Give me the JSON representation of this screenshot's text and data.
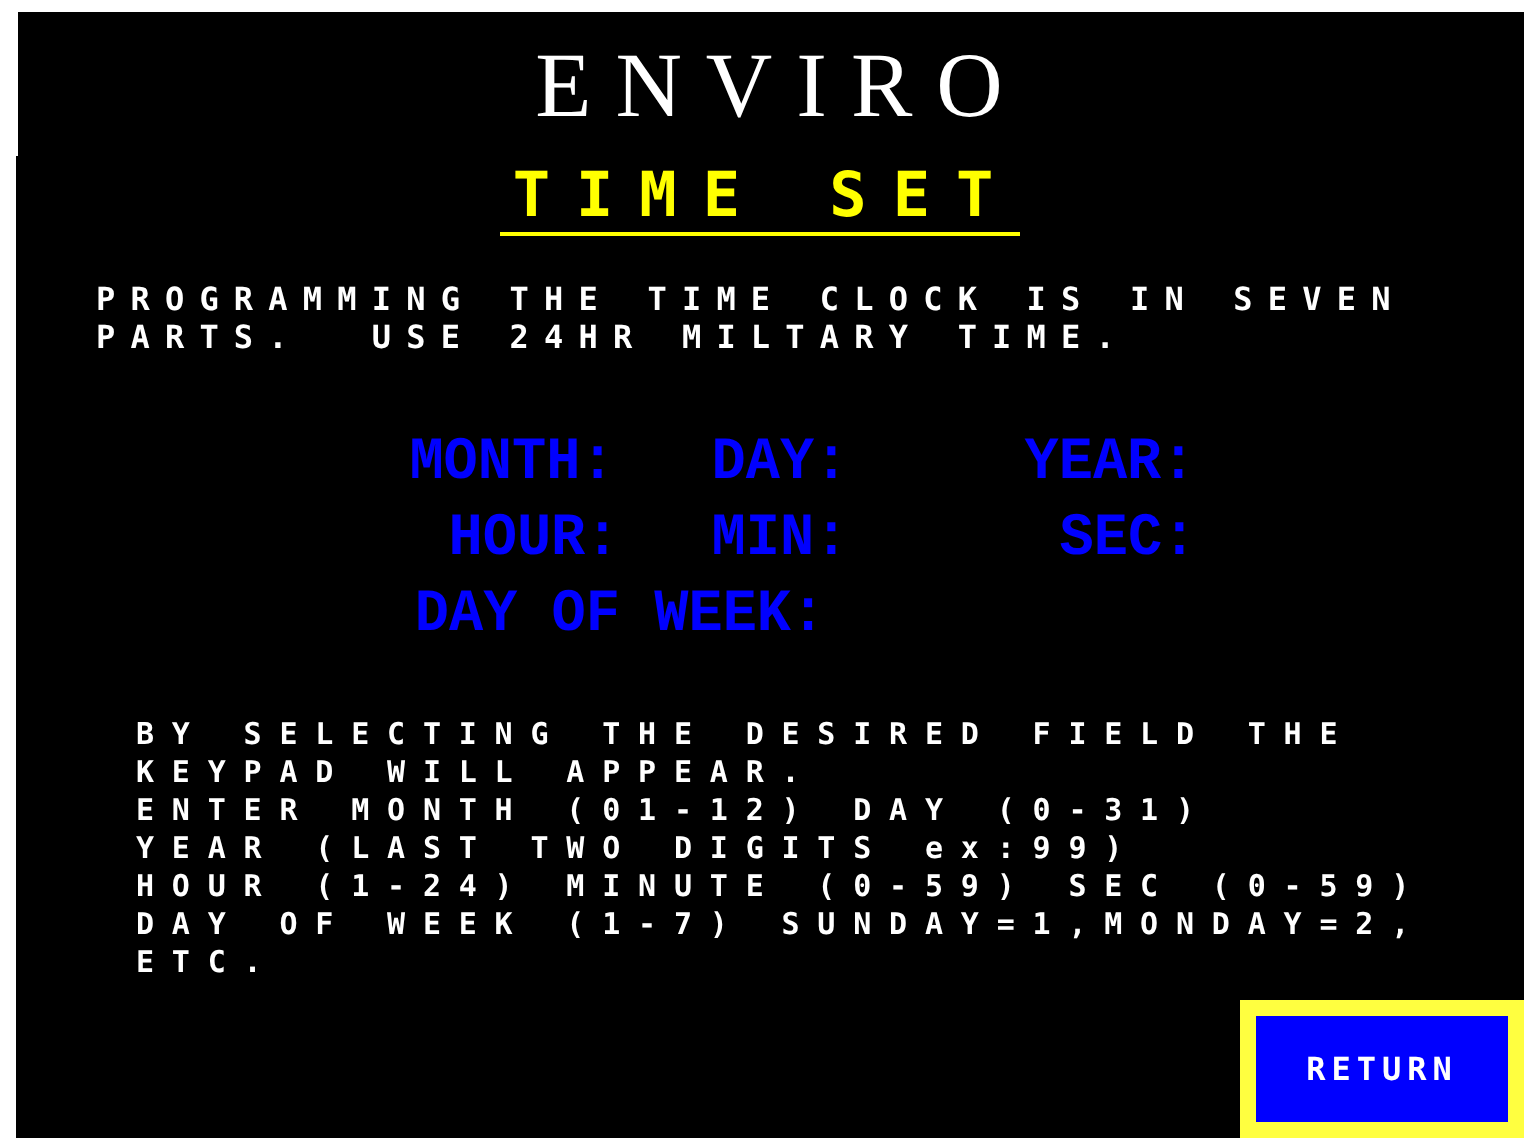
{
  "header": {
    "title": "ENVIRO"
  },
  "screen": {
    "title": "TIME SET",
    "intro": [
      "PROGRAMMING THE TIME CLOCK IS IN SEVEN",
      "PARTS.  USE 24HR MILTARY TIME."
    ],
    "fields": [
      {
        "label": "MONTH:",
        "kind": "left"
      },
      {
        "label": "DAY:",
        "kind": "left"
      },
      {
        "label": "YEAR:",
        "kind": "left"
      },
      {
        "label": "HOUR:",
        "kind": "right"
      },
      {
        "label": "MIN:",
        "kind": "left"
      },
      {
        "label": "SEC:",
        "kind": "right"
      },
      {
        "label": "DAY OF WEEK:",
        "kind": "wide"
      }
    ],
    "instructions": [
      "BY SELECTING THE DESIRED FIELD THE",
      "KEYPAD WILL APPEAR.",
      "ENTER MONTH (01-12) DAY (0-31)",
      "YEAR (LAST TWO DIGITS ex:99)",
      "HOUR (1-24) MINUTE (0-59) SEC (0-59)",
      "DAY OF WEEK (1-7) SUNDAY=1,MONDAY=2,",
      "ETC."
    ],
    "return_button": "RETURN"
  }
}
